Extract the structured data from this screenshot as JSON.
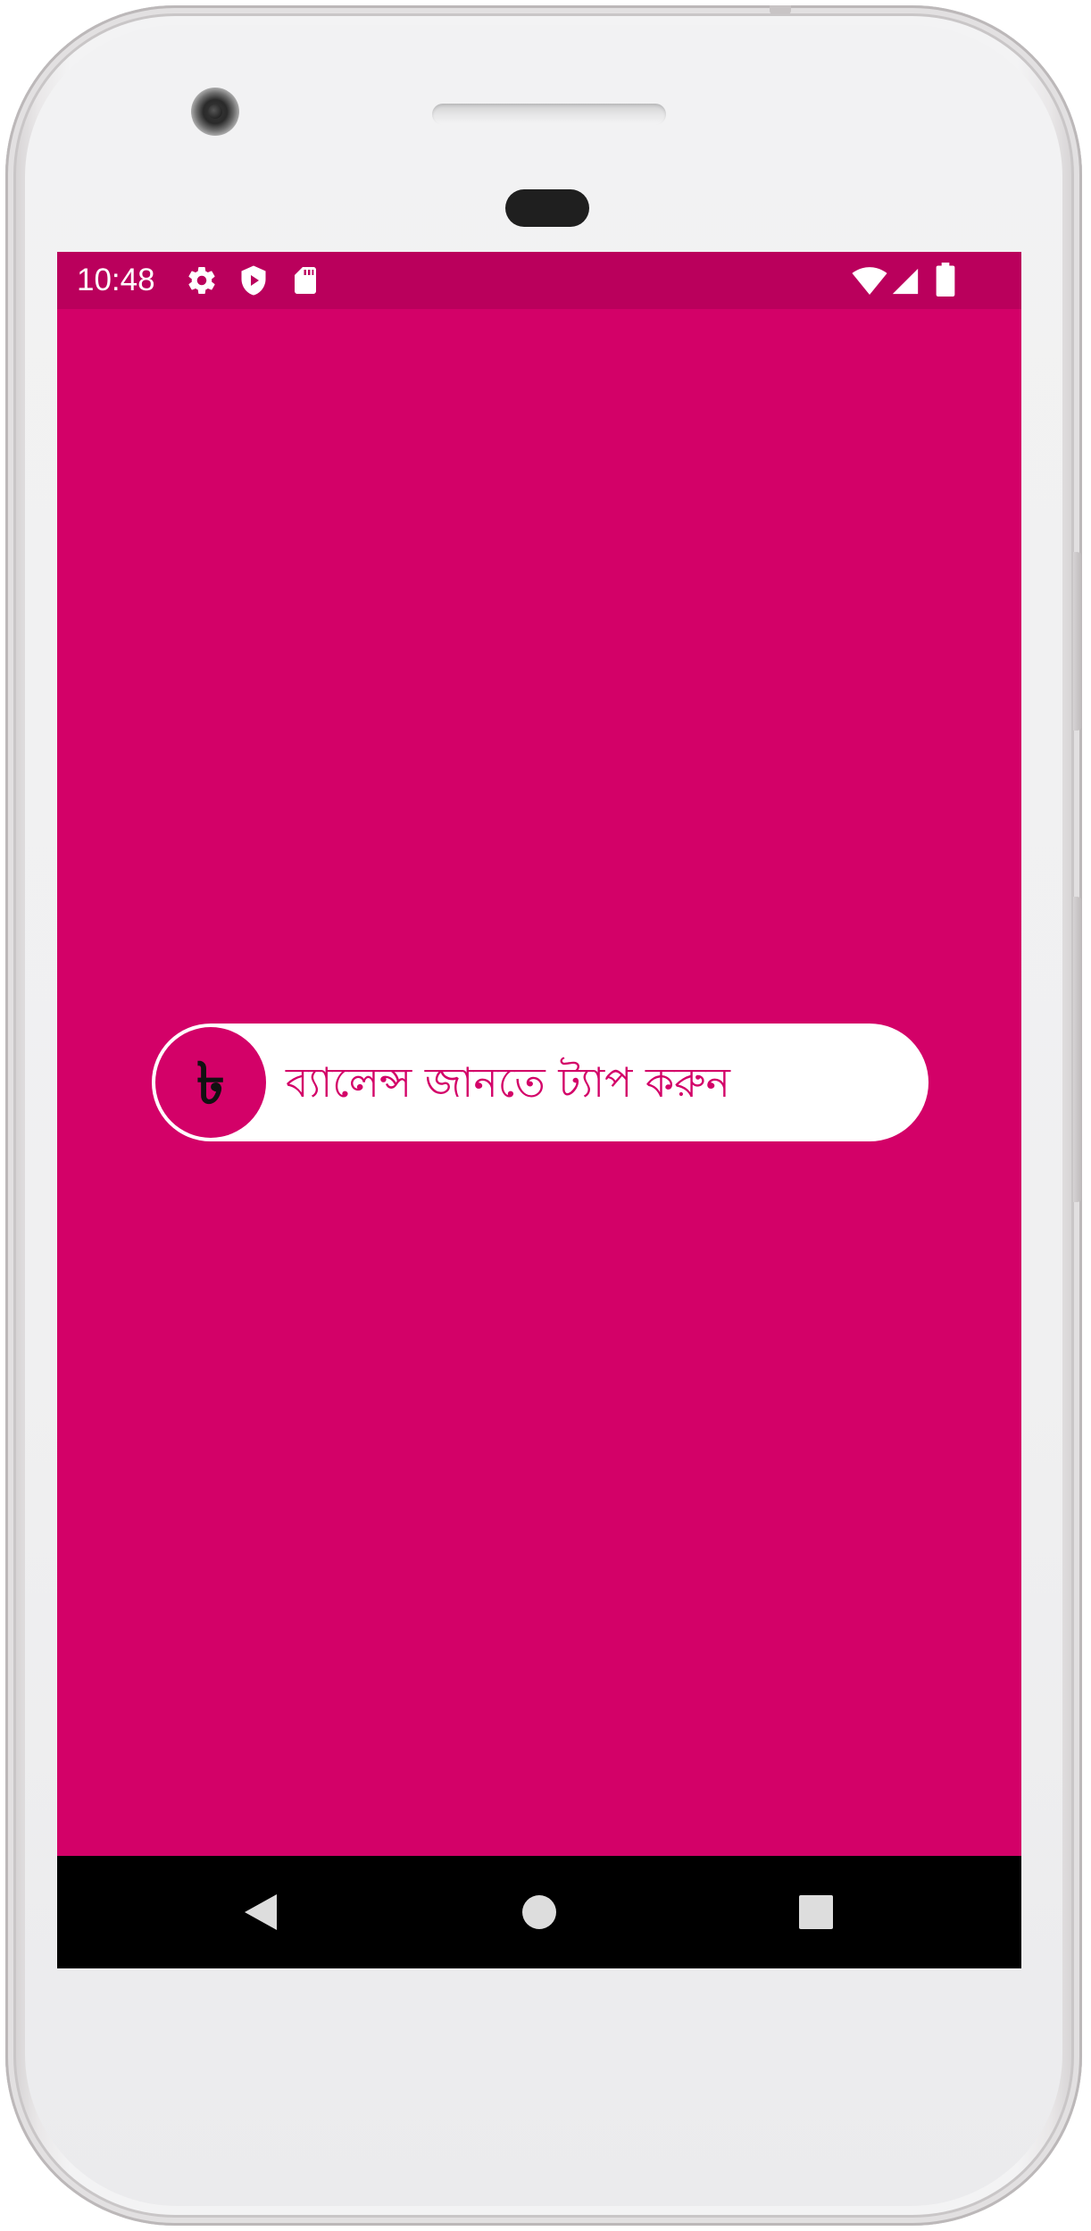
{
  "status_bar": {
    "time": "10:48",
    "left_icons": [
      "gear-icon",
      "shield-play-icon",
      "sd-card-icon"
    ],
    "right_icons": [
      "wifi-icon",
      "cell-signal-icon",
      "battery-icon"
    ]
  },
  "balance_button": {
    "currency_symbol": "৳",
    "label": "ব্যালেন্স জানতে ট্যাপ করুন"
  },
  "nav_bar": {
    "buttons": [
      "back-icon",
      "home-icon",
      "recents-icon"
    ]
  },
  "colors": {
    "screen_background": "#d30168",
    "status_bar": "#ba005c",
    "pill_background": "#ffffff",
    "label_text": "#d30168",
    "nav_bar": "#000000"
  }
}
